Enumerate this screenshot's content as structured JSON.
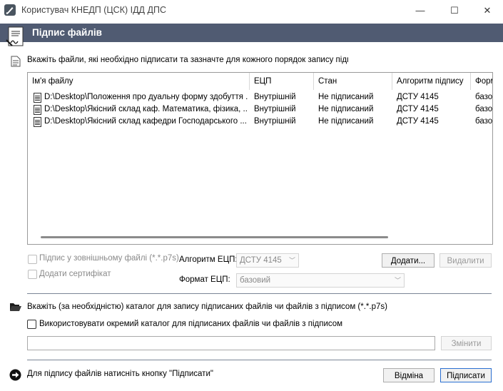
{
  "window": {
    "title": "Користувач КНЕДП (ЦСК) ІДД ДПС",
    "minimize": "—",
    "maximize": "☐",
    "close": "✕"
  },
  "header": {
    "title": "Підпис файлів"
  },
  "files_section": {
    "instruction": "Вкажіть файли, які необхідно підписати та зазначте для кожного порядок запису підпису",
    "columns": [
      "Ім'я файлу",
      "ЕЦП",
      "Стан",
      "Алгоритм підпису",
      "Формат"
    ],
    "rows": [
      [
        "D:\\Desktop\\Положення про дуальну форму здобуття ...",
        "Внутрішній",
        "Не підписаний",
        "ДСТУ 4145",
        "базовий"
      ],
      [
        "D:\\Desktop\\Якісний склад каф. Математика, фізика, ...",
        "Внутрішній",
        "Не підписаний",
        "ДСТУ 4145",
        "базовий"
      ],
      [
        "D:\\Desktop\\Якісний склад кафедри Господарського ...",
        "Внутрішній",
        "Не підписаний",
        "ДСТУ 4145",
        "базовий"
      ]
    ]
  },
  "options": {
    "external_file_label": "Підпис у зовнішньому файлі (*.*.p7s)",
    "add_certificate_label": "Додати сертифікат",
    "algorithm_label": "Алгоритм ЕЦП:",
    "algorithm_value": "ДСТУ 4145",
    "format_label": "Формат ЕЦП:",
    "format_value": "базовий",
    "add_button": "Додати...",
    "remove_button": "Видалити"
  },
  "catalog_section": {
    "instruction": "Вкажіть (за необхідністю) каталог для запису підписаних файлів чи файлів з підписом (*.*.p7s)",
    "separate_catalog_label": "Використовувати окремий каталог для підписаних файлів чи файлів з підписом",
    "path_value": "",
    "change_button": "Змінити"
  },
  "footer": {
    "instruction": "Для підпису файлів натисніть кнопку \"Підписати\"",
    "cancel_button": "Відміна",
    "sign_button": "Підписати"
  }
}
